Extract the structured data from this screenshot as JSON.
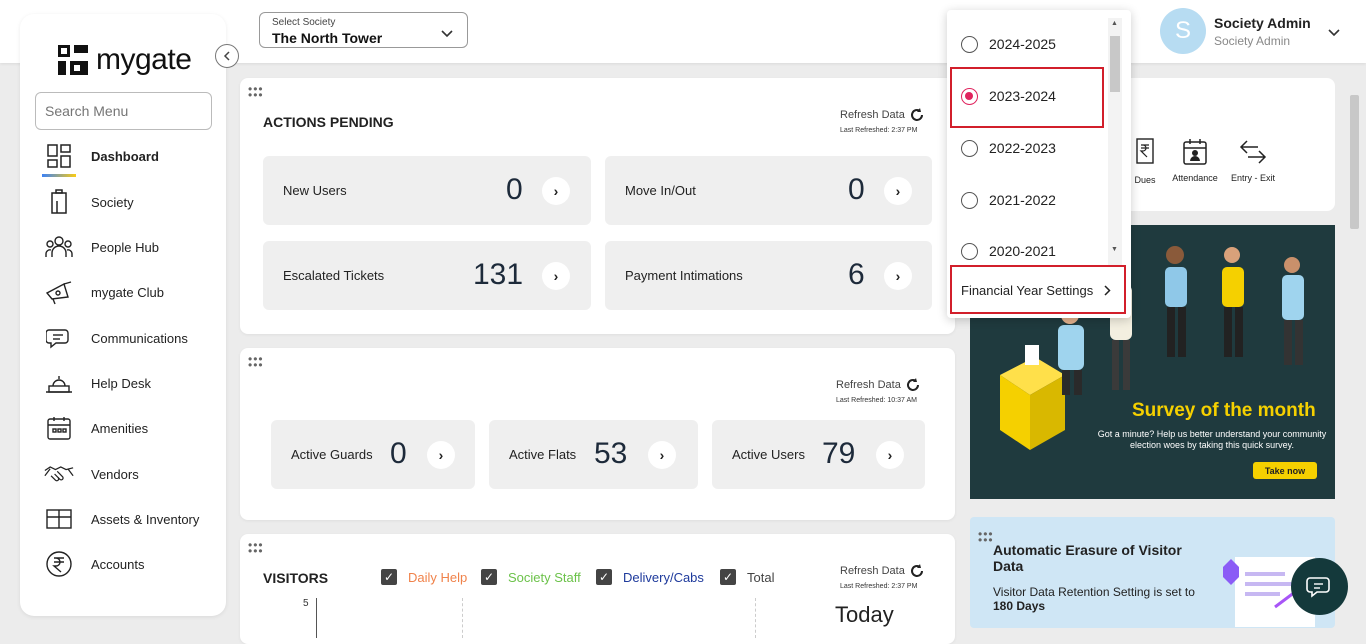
{
  "brand": {
    "name": "mygate"
  },
  "sidebar": {
    "search_placeholder": "Search Menu",
    "items": [
      {
        "label": "Dashboard",
        "icon": "dashboard-icon"
      },
      {
        "label": "Society",
        "icon": "building-icon"
      },
      {
        "label": "People Hub",
        "icon": "people-icon"
      },
      {
        "label": "mygate Club",
        "icon": "club-icon"
      },
      {
        "label": "Communications",
        "icon": "chat-bubble-icon"
      },
      {
        "label": "Help Desk",
        "icon": "help-desk-icon"
      },
      {
        "label": "Amenities",
        "icon": "calendar-icon"
      },
      {
        "label": "Vendors",
        "icon": "handshake-icon"
      },
      {
        "label": "Assets & Inventory",
        "icon": "box-icon"
      },
      {
        "label": "Accounts",
        "icon": "rupee-icon"
      }
    ]
  },
  "header": {
    "society_label": "Select Society",
    "society_value": "The North Tower",
    "user_initial": "S",
    "user_name": "Society Admin",
    "user_role": "Society Admin"
  },
  "actions_pending": {
    "title": "ACTIONS PENDING",
    "refresh_label": "Refresh Data",
    "last_refreshed": "Last Refreshed: 2:37 PM",
    "tiles": [
      {
        "label": "New Users",
        "value": "0"
      },
      {
        "label": "Move In/Out",
        "value": "0"
      },
      {
        "label": "Escalated Tickets",
        "value": "131"
      },
      {
        "label": "Payment Intimations",
        "value": "6"
      }
    ]
  },
  "stats": {
    "refresh_label": "Refresh Data",
    "last_refreshed": "Last Refreshed: 10:37 AM",
    "tiles": [
      {
        "label": "Active Guards",
        "value": "0"
      },
      {
        "label": "Active Flats",
        "value": "53"
      },
      {
        "label": "Active Users",
        "value": "79"
      }
    ]
  },
  "visitors": {
    "title": "VISITORS",
    "refresh_label": "Refresh Data",
    "last_refreshed": "Last Refreshed: 2:37 PM",
    "legend": [
      {
        "label": "Daily Help",
        "color": "#f0824a"
      },
      {
        "label": "Society Staff",
        "color": "#6cc24a"
      },
      {
        "label": "Delivery/Cabs",
        "color": "#1e3a9c"
      },
      {
        "label": "Total",
        "color": "#444444"
      }
    ],
    "y_tick": "5",
    "period": "Today"
  },
  "quick_links": [
    {
      "label": "Dues"
    },
    {
      "label": "Attendance"
    },
    {
      "label": "Entry - Exit"
    }
  ],
  "survey_banner": {
    "title": "Survey of the month",
    "text": "Got a minute? Help us better understand your community election woes by taking this quick survey.",
    "cta": "Take now"
  },
  "erasure": {
    "title": "Automatic Erasure of Visitor Data",
    "text_prefix": "Visitor Data Retention Setting is set to ",
    "text_value": "180 Days"
  },
  "financial_year_dropdown": {
    "options": [
      {
        "label": "2024-2025",
        "selected": false
      },
      {
        "label": "2023-2024",
        "selected": true
      },
      {
        "label": "2022-2023",
        "selected": false
      },
      {
        "label": "2021-2022",
        "selected": false
      },
      {
        "label": "2020-2021",
        "selected": false
      }
    ],
    "settings_label": "Financial Year Settings"
  }
}
